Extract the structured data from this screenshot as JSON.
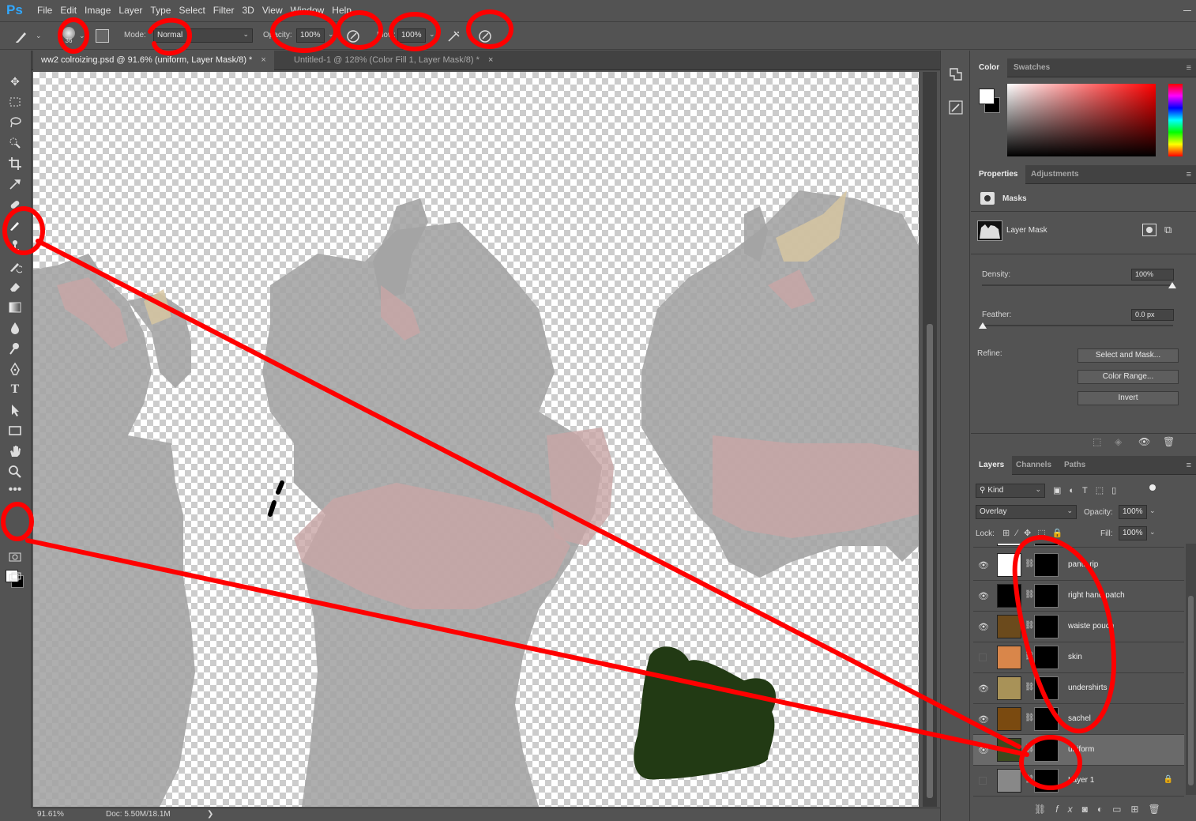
{
  "app": {
    "logo": "Ps"
  },
  "menu": [
    "File",
    "Edit",
    "Image",
    "Layer",
    "Type",
    "Select",
    "Filter",
    "3D",
    "View",
    "Window",
    "Help"
  ],
  "options": {
    "brush_size": "36",
    "mode_label": "Mode:",
    "mode_value": "Normal",
    "opacity_label": "Opacity:",
    "opacity_value": "100%",
    "flow_label": "Flow:",
    "flow_value": "100%"
  },
  "tabs": [
    {
      "label": "ww2 colroizing.psd @ 91.6% (uniform, Layer Mask/8) *",
      "active": true
    },
    {
      "label": "Untitled-1 @ 128% (Color Fill 1, Layer Mask/8) *",
      "active": false
    }
  ],
  "tab_close": "×",
  "status": {
    "zoom": "91.61%",
    "doc": "Doc: 5.50M/18.1M",
    "arrow": "❯"
  },
  "color_panel": {
    "tabs": [
      "Color",
      "Swatches"
    ],
    "active_tab": "Color"
  },
  "properties_panel": {
    "tabs": [
      "Properties",
      "Adjustments"
    ],
    "section": "Masks",
    "mask_type": "Layer Mask",
    "density_label": "Density:",
    "density_value": "100%",
    "feather_label": "Feather:",
    "feather_value": "0.0 px",
    "refine_label": "Refine:",
    "buttons": [
      "Select and Mask...",
      "Color Range...",
      "Invert"
    ]
  },
  "layers_panel": {
    "tabs": [
      "Layers",
      "Channels",
      "Paths"
    ],
    "kind_label": "Kind",
    "blend_mode": "Overlay",
    "opacity_label": "Opacity:",
    "opacity_value": "100%",
    "lock_label": "Lock:",
    "fill_label": "Fill:",
    "fill_value": "100%",
    "layers": [
      {
        "name": "pants rip",
        "visible": true,
        "thumb": "#ffffff",
        "selected": false
      },
      {
        "name": "right hand patch",
        "visible": true,
        "thumb": "#000000",
        "selected": false
      },
      {
        "name": "waiste pouch",
        "visible": true,
        "thumb": "#6b4a1c",
        "selected": false
      },
      {
        "name": "skin",
        "visible": false,
        "thumb": "#d9864a",
        "selected": false
      },
      {
        "name": "undershirts",
        "visible": true,
        "thumb": "#a89258",
        "selected": false
      },
      {
        "name": "sachel",
        "visible": true,
        "thumb": "#7a4a10",
        "selected": false
      },
      {
        "name": "uniform",
        "visible": true,
        "thumb": "#3c4a1e",
        "selected": true
      },
      {
        "name": "Layer 1",
        "visible": false,
        "thumb": "#888888",
        "selected": false
      }
    ]
  },
  "colors": {
    "annotation": "#ff0000",
    "paint_stroke": "#223a14",
    "figure_gray": "#a3a3a3",
    "figure_pink": "#c8a5a5"
  }
}
